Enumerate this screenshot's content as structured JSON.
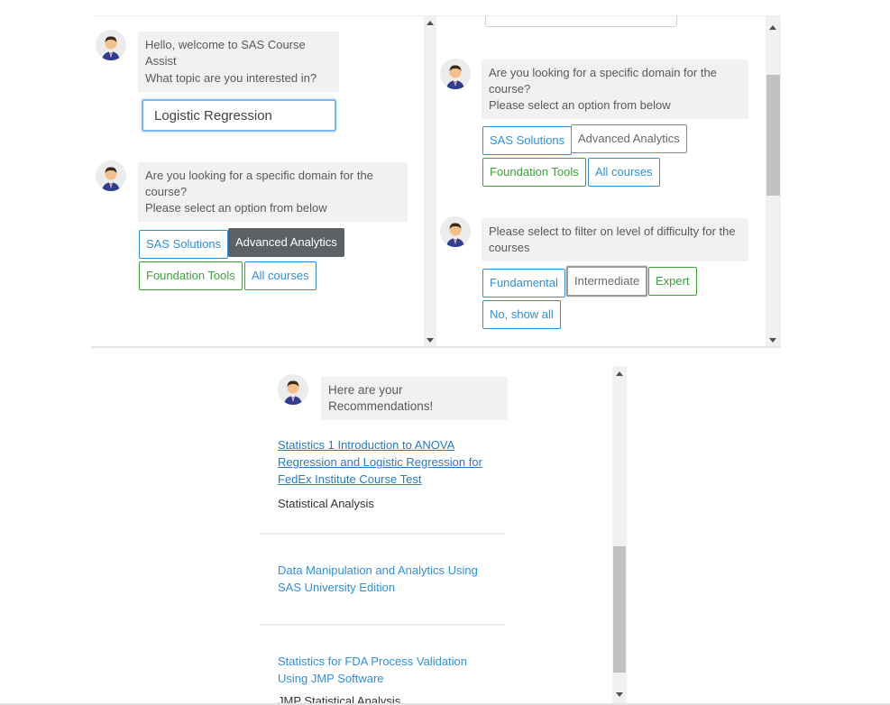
{
  "left_panel": {
    "greeting": "Hello, welcome to SAS Course Assist",
    "topic_question": "What topic are you interested in?",
    "topic_input_value": "Logistic Regression",
    "domain_question_lines": [
      "Are you looking for a specific domain for the",
      "course?",
      "Please select an option from below"
    ],
    "domain_options": [
      "SAS Solutions",
      "Advanced Analytics",
      "Foundation Tools",
      "All courses"
    ]
  },
  "right_panel": {
    "domain_question_lines": [
      "Are you looking for a specific domain for the",
      "course?",
      "Please select an option from below"
    ],
    "domain_options": [
      "SAS Solutions",
      "Advanced Analytics",
      "Foundation Tools",
      "All courses"
    ],
    "difficulty_question_lines": [
      "Please select to filter on level of difficulty for the",
      "courses"
    ],
    "difficulty_options": [
      "Fundamental",
      "Intermediate",
      "Expert",
      "No, show all"
    ]
  },
  "bottom_panel": {
    "recommendations_heading": "Here are your Recommendations!",
    "courses": [
      {
        "title_lines": [
          "Statistics 1 Introduction to ANOVA",
          "Regression and Logistic Regression for",
          "FedEx Institute Course Test"
        ],
        "category": "Statistical Analysis"
      },
      {
        "title_lines": [
          "Data Manipulation and Analytics Using",
          "SAS University Edition"
        ],
        "category": ""
      },
      {
        "title_lines": [
          "Statistics for FDA Process Validation",
          "Using JMP Software"
        ],
        "category": "JMP Statistical Analysis"
      }
    ]
  },
  "colors": {
    "accent_blue": "#2f8fe0",
    "accent_green": "#3aa43a",
    "selected_dark": "#5c6166",
    "bubble_bg": "#f1f1f1"
  },
  "icons": {
    "avatar": "bot-avatar-icon",
    "scroll_up": "scroll-up-arrow-icon",
    "scroll_down": "scroll-down-arrow-icon"
  }
}
